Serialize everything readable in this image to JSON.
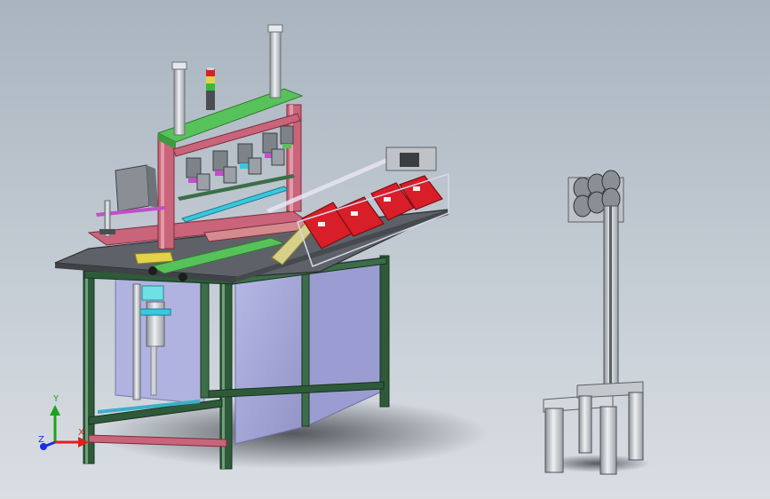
{
  "viewport": {
    "background_top": "#a9b4bf",
    "background_bottom": "#d9dee3"
  },
  "triad": {
    "x_label": "X",
    "y_label": "Y",
    "z_label": "Z",
    "x_color": "#e0201c",
    "y_color": "#1aa41a",
    "z_color": "#1c2ee0"
  },
  "colors": {
    "frame_green": "#2f5a3a",
    "frame_pink": "#c9647a",
    "rail_green": "#58c25a",
    "tray_red": "#d81e28",
    "panel_lavender": "#a7a8d8",
    "table_top": "#5e6268",
    "cylinder_silver": "#d4d8dc",
    "accent_yellow": "#e3d34a",
    "accent_cyan": "#38c8e0",
    "accent_magenta": "#c050c8"
  },
  "icons": {
    "machine": "assembly-machine-icon",
    "stand": "spool-stand-icon",
    "light": "signal-tower-icon"
  }
}
